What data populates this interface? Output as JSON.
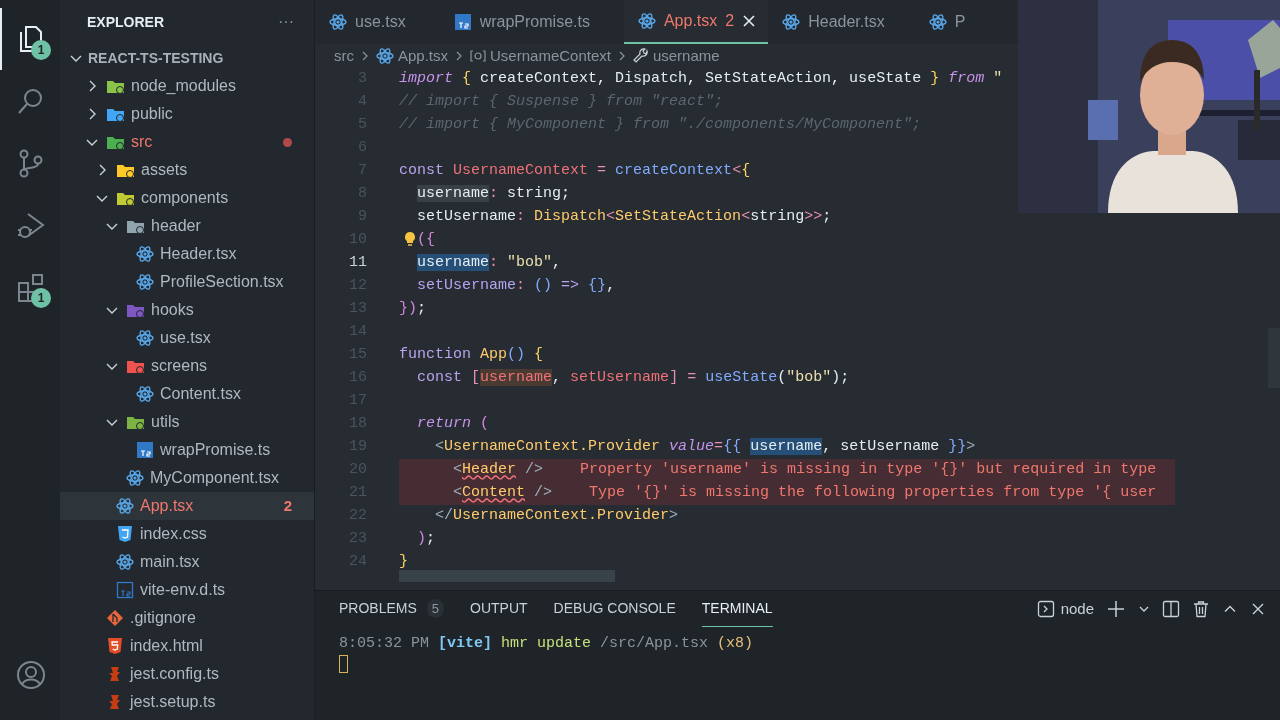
{
  "activity_bar": {
    "items": [
      {
        "kind": "explorer",
        "selected": true,
        "badge": "1"
      },
      {
        "kind": "search",
        "selected": false
      },
      {
        "kind": "source-control",
        "selected": false
      },
      {
        "kind": "run-debug",
        "selected": false
      },
      {
        "kind": "extensions",
        "selected": false,
        "badge": "1"
      },
      {
        "kind": "account",
        "selected": false
      }
    ]
  },
  "sidebar": {
    "title": "EXPLORER",
    "more": "···",
    "root": {
      "label": "REACT-TS-TESTING",
      "expanded": true,
      "children": [
        {
          "label": "node_modules",
          "kind": "folder",
          "color": "#8bc34a",
          "expanded": false,
          "selected": false,
          "error": false
        },
        {
          "label": "public",
          "kind": "folder",
          "color": "#42a5f5",
          "expanded": false,
          "selected": false,
          "error": false
        },
        {
          "label": "src",
          "kind": "folder",
          "color": "#4caf50",
          "expanded": true,
          "selected": false,
          "error": true,
          "children": [
            {
              "label": "assets",
              "kind": "folder",
              "color": "#ffca28",
              "expanded": false,
              "selected": false,
              "error": false
            },
            {
              "label": "components",
              "kind": "folder",
              "color": "#c0ca33",
              "expanded": true,
              "selected": false,
              "error": false,
              "children": [
                {
                  "label": "header",
                  "kind": "folder",
                  "color": "#90a4ae",
                  "expanded": true,
                  "selected": false,
                  "error": false,
                  "children": [
                    {
                      "label": "Header.tsx",
                      "kind": "react",
                      "selected": false,
                      "error": false
                    },
                    {
                      "label": "ProfileSection.tsx",
                      "kind": "react",
                      "selected": false,
                      "error": false
                    }
                  ]
                },
                {
                  "label": "hooks",
                  "kind": "folder",
                  "color": "#7e57c2",
                  "expanded": true,
                  "selected": false,
                  "error": false,
                  "children": [
                    {
                      "label": "use.tsx",
                      "kind": "react",
                      "selected": false,
                      "error": false
                    }
                  ]
                },
                {
                  "label": "screens",
                  "kind": "folder",
                  "color": "#ef5350",
                  "expanded": true,
                  "selected": false,
                  "error": false,
                  "children": [
                    {
                      "label": "Content.tsx",
                      "kind": "react",
                      "selected": false,
                      "error": false
                    }
                  ]
                },
                {
                  "label": "utils",
                  "kind": "folder",
                  "color": "#7cb342",
                  "expanded": true,
                  "selected": false,
                  "error": false,
                  "children": [
                    {
                      "label": "wrapPromise.ts",
                      "kind": "ts",
                      "selected": false,
                      "error": false
                    }
                  ]
                },
                {
                  "label": "MyComponent.tsx",
                  "kind": "react",
                  "selected": false,
                  "error": false
                }
              ]
            },
            {
              "label": "App.tsx",
              "kind": "react",
              "selected": true,
              "error": true,
              "badge": "2"
            },
            {
              "label": "index.css",
              "kind": "css",
              "selected": false,
              "error": false
            },
            {
              "label": "main.tsx",
              "kind": "react",
              "selected": false,
              "error": false
            },
            {
              "label": "vite-env.d.ts",
              "kind": "ts-decl",
              "selected": false,
              "error": false
            }
          ]
        },
        {
          "label": ".gitignore",
          "kind": "git",
          "selected": false,
          "error": false
        },
        {
          "label": "index.html",
          "kind": "html",
          "selected": false,
          "error": false
        },
        {
          "label": "jest.config.ts",
          "kind": "jest",
          "selected": false,
          "error": false
        },
        {
          "label": "jest.setup.ts",
          "kind": "jest",
          "selected": false,
          "error": false
        }
      ]
    }
  },
  "tabs": [
    {
      "label": "use.tsx",
      "kind": "react",
      "selected": false,
      "error": false
    },
    {
      "label": "wrapPromise.ts",
      "kind": "ts",
      "selected": false,
      "error": false
    },
    {
      "label": "App.tsx",
      "kind": "react",
      "selected": true,
      "error": true,
      "badge": "2"
    },
    {
      "label": "Header.tsx",
      "kind": "react",
      "selected": false,
      "error": false
    },
    {
      "label": "P",
      "kind": "react",
      "selected": false,
      "error": false
    }
  ],
  "breadcrumb": [
    {
      "label": "src",
      "kind": "folder"
    },
    {
      "label": "App.tsx",
      "kind": "react"
    },
    {
      "label": "UsernameContext",
      "kind": "symbol"
    },
    {
      "label": "username",
      "kind": "property"
    }
  ],
  "editor": {
    "lines": [
      {
        "number": "3",
        "current": false,
        "error": false,
        "tokens": [
          {
            "text": "import",
            "kind": "kw"
          },
          {
            "text": " {",
            "kind": "brace"
          },
          {
            "text": " createContext, Dispatch, SetStateAction, useState ",
            "kind": "plain"
          },
          {
            "text": "}",
            "kind": "brace"
          },
          {
            "text": " from",
            "kind": "kw"
          },
          {
            "text": " \"",
            "kind": "string"
          }
        ]
      },
      {
        "number": "4",
        "current": false,
        "error": false,
        "tokens": [
          {
            "text": "// import { Suspense } from \"react\";",
            "kind": "comment"
          }
        ]
      },
      {
        "number": "5",
        "current": false,
        "error": false,
        "tokens": [
          {
            "text": "// import { MyComponent } from \"./components/MyComponent\";",
            "kind": "comment"
          }
        ]
      },
      {
        "number": "6",
        "current": false,
        "error": false
      },
      {
        "number": "7",
        "current": false,
        "error": false,
        "tokens": [
          {
            "text": "const",
            "kind": "storage"
          },
          {
            "text": " UsernameContext",
            "kind": "var"
          },
          {
            "text": " = ",
            "kind": "op"
          },
          {
            "text": "createContext",
            "kind": "func"
          },
          {
            "text": "<",
            "kind": "op"
          },
          {
            "text": "{",
            "kind": "brace"
          }
        ]
      },
      {
        "number": "8",
        "current": false,
        "error": false,
        "tokens": [
          {
            "text": "  username",
            "kind": "plain",
            "highlighted": true
          },
          {
            "text": ": ",
            "kind": "op"
          },
          {
            "text": "string",
            "kind": "plain"
          },
          {
            "text": ";",
            "kind": "plain"
          }
        ]
      },
      {
        "number": "9",
        "current": false,
        "error": false,
        "tokens": [
          {
            "text": "  setUsername",
            "kind": "plain"
          },
          {
            "text": ": ",
            "kind": "op"
          },
          {
            "text": "Dispatch",
            "kind": "type"
          },
          {
            "text": "<",
            "kind": "op"
          },
          {
            "text": "SetStateAction",
            "kind": "type"
          },
          {
            "text": "<",
            "kind": "op"
          },
          {
            "text": "string",
            "kind": "plain"
          },
          {
            "text": ">>",
            "kind": "op"
          },
          {
            "text": ";",
            "kind": "plain"
          }
        ]
      },
      {
        "number": "10",
        "current": false,
        "error": false,
        "lightbulb": true,
        "tokens": [
          {
            "text": "({",
            "kind": "brace2"
          }
        ]
      },
      {
        "number": "11",
        "current": true,
        "error": false,
        "tokens": [
          {
            "text": "  username",
            "kind": "plain",
            "selected": true
          },
          {
            "text": ": ",
            "kind": "op"
          },
          {
            "text": "\"bob\"",
            "kind": "string"
          },
          {
            "text": ",",
            "kind": "plain"
          }
        ]
      },
      {
        "number": "12",
        "current": false,
        "error": false,
        "tokens": [
          {
            "text": "  setUsername",
            "kind": "method"
          },
          {
            "text": ": ",
            "kind": "op"
          },
          {
            "text": "()",
            "kind": "func"
          },
          {
            "text": " => ",
            "kind": "storage"
          },
          {
            "text": "{}",
            "kind": "func"
          },
          {
            "text": ",",
            "kind": "plain"
          }
        ]
      },
      {
        "number": "13",
        "current": false,
        "error": false,
        "tokens": [
          {
            "text": "})",
            "kind": "brace2"
          },
          {
            "text": ";",
            "kind": "plain"
          }
        ]
      },
      {
        "number": "14",
        "current": false,
        "error": false
      },
      {
        "number": "15",
        "current": false,
        "error": false,
        "tokens": [
          {
            "text": "function",
            "kind": "storage"
          },
          {
            "text": " App",
            "kind": "type"
          },
          {
            "text": "()",
            "kind": "func"
          },
          {
            "text": " {",
            "kind": "brace"
          }
        ]
      },
      {
        "number": "16",
        "current": false,
        "error": false,
        "tokens": [
          {
            "text": "  const",
            "kind": "storage"
          },
          {
            "text": " [",
            "kind": "op"
          },
          {
            "text": "username",
            "kind": "var",
            "write_access": true
          },
          {
            "text": ", ",
            "kind": "plain"
          },
          {
            "text": "setUsername",
            "kind": "var"
          },
          {
            "text": "] = ",
            "kind": "op"
          },
          {
            "text": "useState",
            "kind": "func"
          },
          {
            "text": "(",
            "kind": "plain"
          },
          {
            "text": "\"bob\"",
            "kind": "string"
          },
          {
            "text": ");",
            "kind": "plain"
          }
        ]
      },
      {
        "number": "17",
        "current": false,
        "error": false
      },
      {
        "number": "18",
        "current": false,
        "error": false,
        "tokens": [
          {
            "text": "  return",
            "kind": "kw"
          },
          {
            "text": " (",
            "kind": "brace2"
          }
        ]
      },
      {
        "number": "19",
        "current": false,
        "error": false,
        "tokens": [
          {
            "text": "    <",
            "kind": "tagp"
          },
          {
            "text": "UsernameContext.Provider",
            "kind": "tag"
          },
          {
            "text": " value",
            "kind": "attr"
          },
          {
            "text": "=",
            "kind": "op"
          },
          {
            "text": "{{ ",
            "kind": "func"
          },
          {
            "text": "username",
            "kind": "plain",
            "selected": true
          },
          {
            "text": ", setUsername ",
            "kind": "plain"
          },
          {
            "text": "}}",
            "kind": "func"
          },
          {
            "text": ">",
            "kind": "tagp"
          }
        ]
      },
      {
        "number": "20",
        "current": false,
        "error": true,
        "message": "Property 'username' is missing in type '{}' but required in type",
        "tokens": [
          {
            "text": "      <",
            "kind": "tagp"
          },
          {
            "text": "Header",
            "kind": "tag",
            "squiggle": true
          },
          {
            "text": " />",
            "kind": "tagp"
          }
        ]
      },
      {
        "number": "21",
        "current": false,
        "error": true,
        "message": "Type '{}' is missing the following properties from type '{ user",
        "tokens": [
          {
            "text": "      <",
            "kind": "tagp"
          },
          {
            "text": "Content",
            "kind": "tag",
            "squiggle": true
          },
          {
            "text": " />",
            "kind": "tagp"
          }
        ]
      },
      {
        "number": "22",
        "current": false,
        "error": false,
        "tokens": [
          {
            "text": "    </",
            "kind": "tagp"
          },
          {
            "text": "UsernameContext.Provider",
            "kind": "tag"
          },
          {
            "text": ">",
            "kind": "tagp"
          }
        ]
      },
      {
        "number": "23",
        "current": false,
        "error": false,
        "tokens": [
          {
            "text": "  )",
            "kind": "brace2"
          },
          {
            "text": ";",
            "kind": "plain"
          }
        ]
      },
      {
        "number": "24",
        "current": false,
        "error": false,
        "tokens": [
          {
            "text": "}",
            "kind": "brace"
          }
        ]
      }
    ]
  },
  "panel": {
    "tabs": [
      {
        "label": "PROBLEMS",
        "selected": false,
        "badge": "5"
      },
      {
        "label": "OUTPUT",
        "selected": false
      },
      {
        "label": "DEBUG CONSOLE",
        "selected": false
      },
      {
        "label": "TERMINAL",
        "selected": true
      }
    ],
    "shell": "node",
    "terminal": [
      {
        "text": "8:05:32 PM",
        "kind": "time"
      },
      {
        "text": "[vite]",
        "kind": "tag"
      },
      {
        "text": "hmr update",
        "kind": "action"
      },
      {
        "text": "/src/App.tsx",
        "kind": "path"
      },
      {
        "text": "(x8)",
        "kind": "count"
      }
    ]
  }
}
